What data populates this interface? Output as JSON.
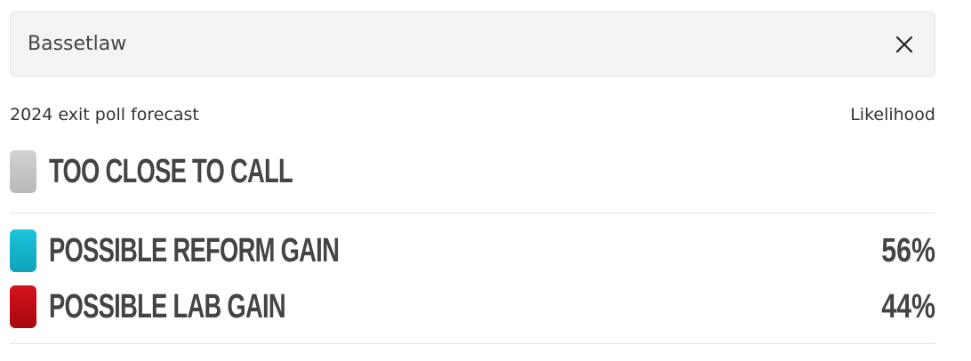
{
  "search": {
    "value": "Bassetlaw",
    "clear_icon": "close-icon"
  },
  "header": {
    "left_label": "2024 exit poll forecast",
    "right_label": "Likelihood"
  },
  "forecast": {
    "headline": {
      "label": "TOO CLOSE TO CALL",
      "color": "#c8c8c8"
    },
    "outcomes": [
      {
        "label": "POSSIBLE REFORM GAIN",
        "likelihood": "56%",
        "color": "#12b6cf"
      },
      {
        "label": "POSSIBLE LAB GAIN",
        "likelihood": "44%",
        "color": "#c00a15"
      }
    ]
  }
}
